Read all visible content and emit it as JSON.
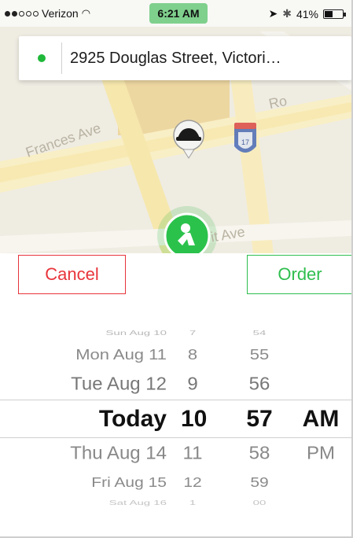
{
  "status_bar": {
    "carrier": "Verizon",
    "time": "6:21 AM",
    "battery": "41%",
    "battery_level": 0.41,
    "signal_bars": 2
  },
  "map": {
    "street_labels": [
      "Frances Ave",
      "Ro",
      "it Ave"
    ]
  },
  "address": {
    "text": "2925 Douglas Street, Victori…"
  },
  "buttons": {
    "cancel_label": "Cancel",
    "order_label": "Order"
  },
  "colors": {
    "cancel": "#e8343b",
    "order": "#2fbe4e",
    "location_dot": "#1fb83a"
  },
  "picker": {
    "rows": [
      {
        "date": "Sun Aug 10",
        "hour": "7",
        "minute": "54",
        "ampm": ""
      },
      {
        "date": "Mon Aug 11",
        "hour": "8",
        "minute": "55",
        "ampm": ""
      },
      {
        "date": "Tue Aug 12",
        "hour": "9",
        "minute": "56",
        "ampm": ""
      },
      {
        "date": "Today",
        "hour": "10",
        "minute": "57",
        "ampm": "AM"
      },
      {
        "date": "Thu Aug 14",
        "hour": "11",
        "minute": "58",
        "ampm": "PM"
      },
      {
        "date": "Fri Aug 15",
        "hour": "12",
        "minute": "59",
        "ampm": ""
      },
      {
        "date": "Sat Aug 16",
        "hour": "1",
        "minute": "00",
        "ampm": ""
      }
    ],
    "selected_index": 3
  }
}
